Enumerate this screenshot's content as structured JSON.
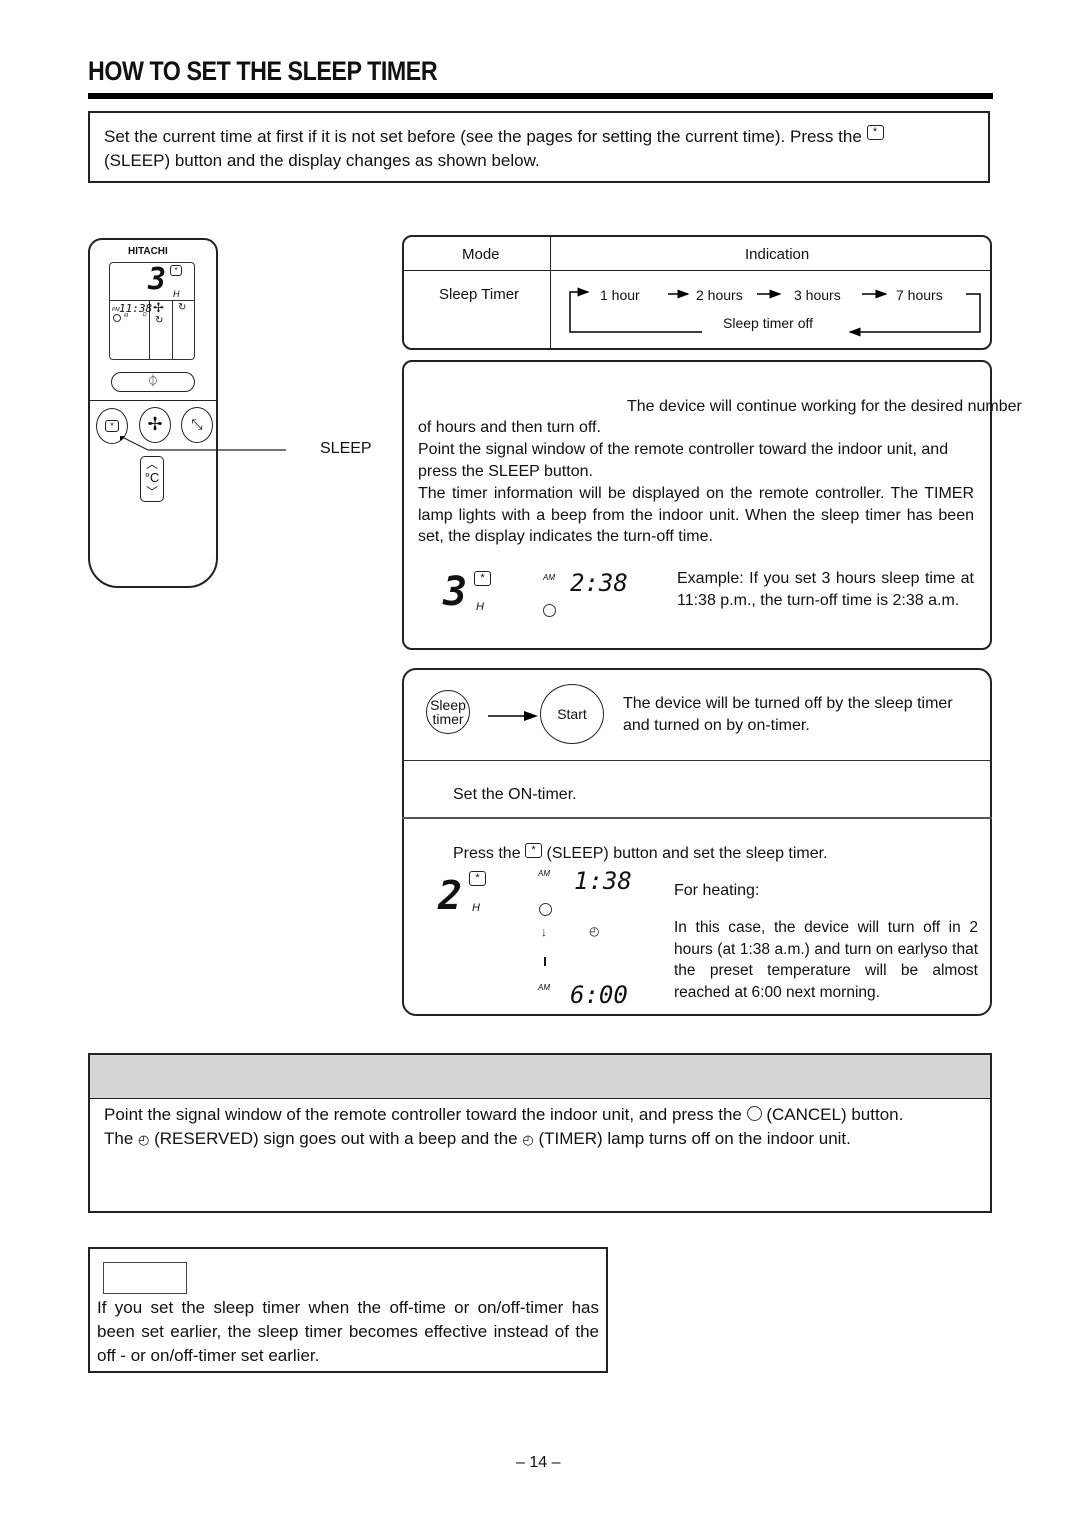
{
  "page": {
    "title": "HOW TO SET THE SLEEP TIMER",
    "page_number": "– 14 –"
  },
  "intro": {
    "text_before_icon": "Set the current time at first if it is not set before (see the pages for setting the current time). Press the",
    "icon": "sleep-icon",
    "text_after_icon": "(SLEEP) button and the display changes as shown below."
  },
  "remote": {
    "brand": "HITACHI",
    "lcd_hours": "3",
    "lcd_hours_unit": "H",
    "lcd_clock_ampm": "PM",
    "lcd_clock": "11:38",
    "lcd_sub_m": "M",
    "lcd_sub_d": "D",
    "sleep_symbol": "*",
    "power_symbol": "⏀",
    "temp_up": "^",
    "temp_label": "°C",
    "temp_down": "v",
    "callout_label": "SLEEP"
  },
  "mode_table": {
    "header_mode": "Mode",
    "header_indication": "Indication",
    "row_mode": "Sleep Timer",
    "sequence": [
      "1 hour",
      "2 hours",
      "3 hours",
      "7 hours"
    ],
    "return_label": "Sleep timer off"
  },
  "step1": {
    "line1": "The device will continue working for the desired number",
    "line2": "of hours and then turn off.",
    "para2": "Point the signal window of the remote controller toward the indoor unit, and press the SLEEP button.",
    "para3": "The timer information will be displayed on the remote controller. The TIMER lamp lights with a beep from the indoor unit. When the sleep timer has been set, the display indicates the turn-off time.",
    "display_hours": "3",
    "display_unit": "H",
    "display_ampm": "AM",
    "display_time": "2:38",
    "example": "Example: If you set 3 hours sleep time at 11:38 p.m., the turn-off time is 2:38 a.m."
  },
  "step2": {
    "circle1": "Sleep timer",
    "circle2": "Start",
    "description": "The device will be turned off by the sleep timer and turned on by on-timer.",
    "set_on_timer": "Set the ON-timer.",
    "press_before": "Press the",
    "press_after": "(SLEEP) button and set the sleep timer.",
    "display_hours": "2",
    "display_unit": "H",
    "display_ampm_1": "AM",
    "display_time_1": "1:38",
    "display_ampm_2": "AM",
    "display_time_2": "6:00",
    "for_heating": "For heating:",
    "heating_text": "In this case, the device will turn off in 2 hours (at 1:38 a.m.) and turn on earlyso that the preset temperature will be almost reached at 6:00 next morning."
  },
  "cancel": {
    "header": "",
    "line1_before": "Point the signal window of the remote controller toward the indoor unit, and press the",
    "line1_after": "(CANCEL) button.",
    "line2_a": "The",
    "line2_b": "(RESERVED) sign goes out with a beep and the",
    "line2_c": "(TIMER) lamp turns off on the indoor unit."
  },
  "note": {
    "label": "",
    "text": "If you set the sleep timer when the off-time or on/off-timer has been set earlier, the sleep timer becomes effective instead of the off - or on/off-timer set earlier."
  }
}
